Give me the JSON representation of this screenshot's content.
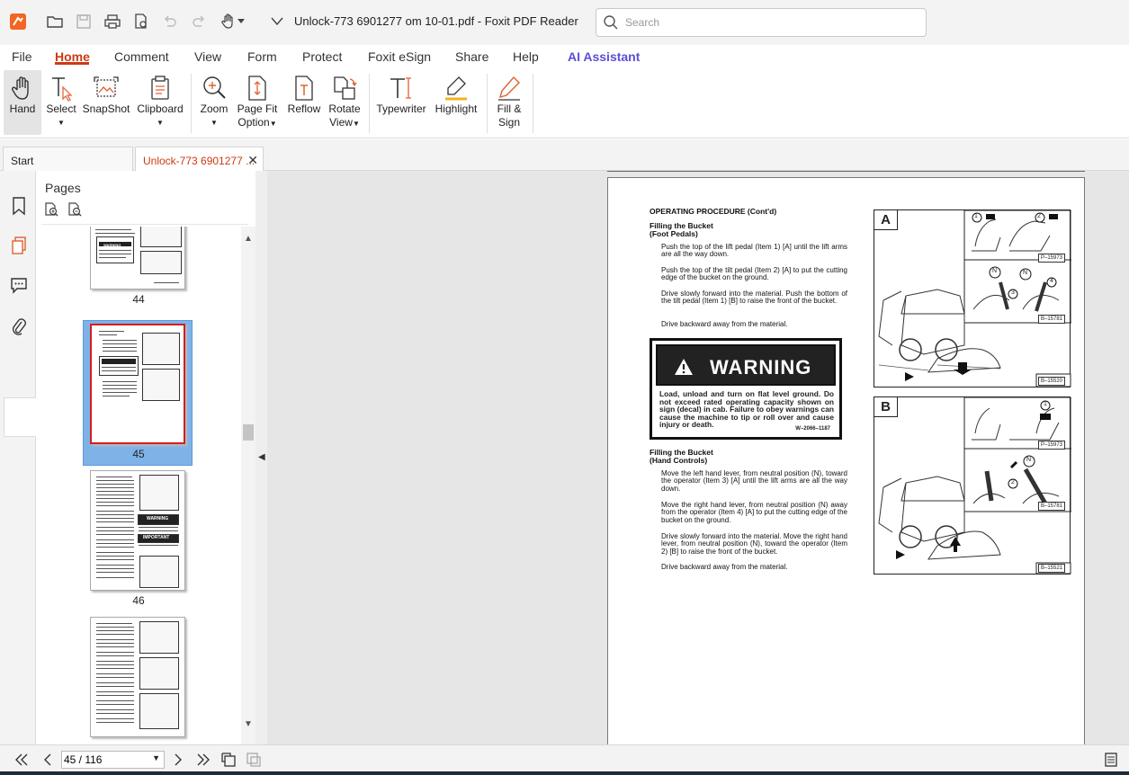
{
  "titlebar": {
    "title": "Unlock-773 6901277 om 10-01.pdf - Foxit PDF Reader",
    "search_placeholder": "Search",
    "icons": [
      "foxit-logo-icon",
      "open-folder-icon",
      "save-icon",
      "print-icon",
      "print-preview-icon",
      "undo-icon",
      "redo-icon",
      "hand-tool-icon",
      "customize-toolbar-icon"
    ]
  },
  "menu": {
    "items": [
      "File",
      "Home",
      "Comment",
      "View",
      "Form",
      "Protect",
      "Foxit eSign",
      "Share",
      "Help",
      "AI Assistant"
    ],
    "active": "Home"
  },
  "ribbon": {
    "hand": "Hand",
    "select": "Select",
    "snapshot": "SnapShot",
    "clipboard": "Clipboard",
    "zoom": "Zoom",
    "page_fit_1": "Page Fit",
    "page_fit_2": "Option",
    "reflow": "Reflow",
    "rotate_1": "Rotate",
    "rotate_2": "View",
    "typewriter": "Typewriter",
    "highlight": "Highlight",
    "fill_1": "Fill &",
    "fill_2": "Sign"
  },
  "tabs": {
    "start": "Start",
    "doc": "Unlock-773 6901277 ..."
  },
  "pages_panel": {
    "title": "Pages",
    "thumbnails": [
      {
        "label": "44"
      },
      {
        "label": "45"
      },
      {
        "label": "46"
      },
      {
        "label": ""
      }
    ],
    "selected": "45"
  },
  "document": {
    "heading": "OPERATING PROCEDURE (Cont'd)",
    "sub1_line1": "Filling the Bucket",
    "sub1_line2": "(Foot Pedals)",
    "p1": "Push the top of the lift pedal (Item 1) [A] until the lift arms are all the way down.",
    "p2": "Push the top of the tilt pedal (Item 2) [A] to put the cutting edge of the bucket on the ground.",
    "p3": "Drive slowly forward into the material. Push the bottom of the tilt pedal (Item 1) [B] to raise the front of the bucket.",
    "p4": "Drive backward away from the material.",
    "warning_title": "WARNING",
    "warning_text": "Load, unload and turn on flat level ground. Do not exceed rated operating capacity shown on sign (decal) in cab. Failure to obey warnings can cause the machine to tip or roll over and cause injury or death.",
    "warning_code": "W–2066–1187",
    "sub2_line1": "Filling the Bucket",
    "sub2_line2": "(Hand Controls)",
    "p5": "Move the left hand lever, from neutral position (N), toward the operator (Item 3) [A] until the lift arms are all the way down.",
    "p6": "Move the right hand lever, from neutral position (N) away from the operator (Item 4) [A] to put the cutting edge of the bucket on the ground.",
    "p7": "Drive slowly forward into the material. Move the right hand lever, from neutral position (N), toward the operator (Item 2) [B] to raise the front of the bucket.",
    "p8": "Drive backward away from the material.",
    "figA": {
      "letter": "A",
      "code1": "P–15973",
      "code2": "B–15781",
      "code3": "B–15520",
      "callouts": [
        "1",
        "2",
        "N",
        "3",
        "N",
        "4"
      ]
    },
    "figB": {
      "letter": "B",
      "code1": "P–15973",
      "code2": "B–15781",
      "code3": "B–15521",
      "callouts": [
        "1",
        "2",
        "N"
      ]
    },
    "thumb_warning": "WARNING",
    "thumb_important": "IMPORTANT"
  },
  "bottombar": {
    "page_value": "45 / 116"
  }
}
